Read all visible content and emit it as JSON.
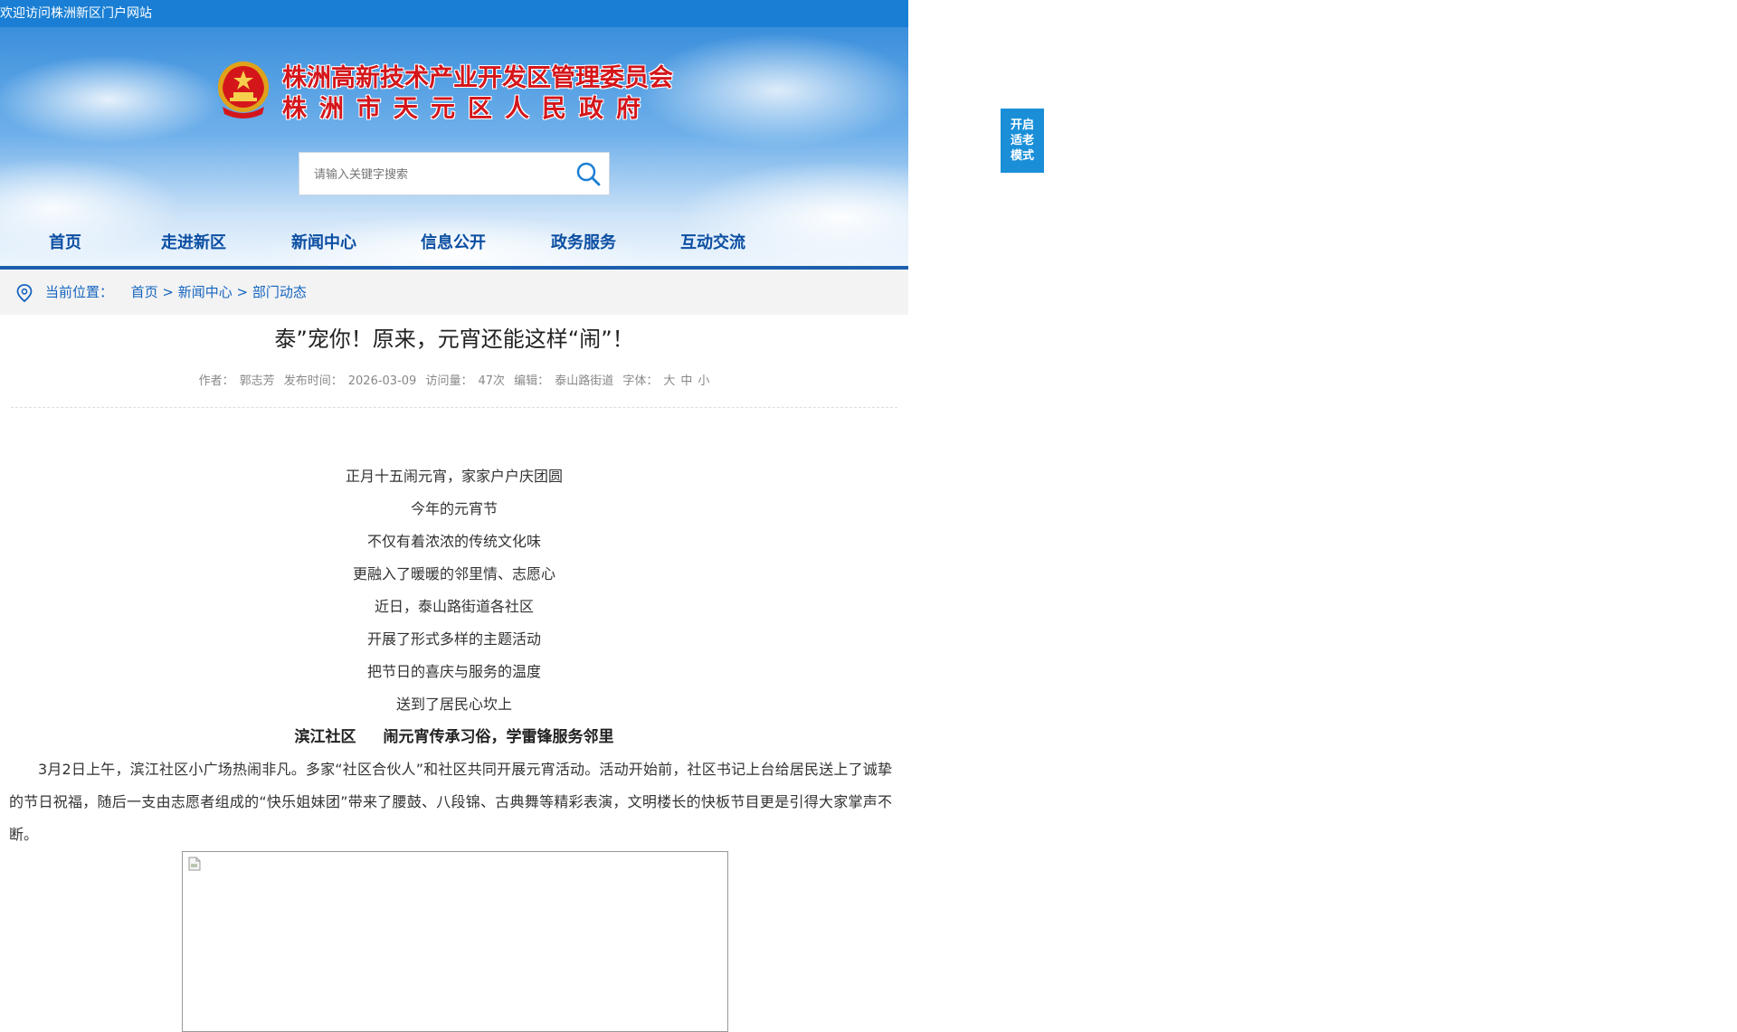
{
  "topbar": {
    "welcome": "欢迎访问株洲新区门户网站"
  },
  "header": {
    "title_line1": "株洲高新技术产业开发区管理委员会",
    "title_line2": "株洲市天元区人民政府",
    "search_placeholder": "请输入关键字搜索"
  },
  "nav": {
    "items": [
      "首页",
      "走进新区",
      "新闻中心",
      "信息公开",
      "政务服务",
      "互动交流"
    ]
  },
  "breadcrumb": {
    "label": "当前位置：",
    "path": [
      "首页",
      "新闻中心",
      "部门动态"
    ],
    "separator": ">"
  },
  "article": {
    "title": "泰”宠你！原来，元宵还能这样“闹”！",
    "meta": {
      "author_label": "作者：",
      "author": "郭志芳",
      "date_label": "发布时间：",
      "date": "2026-03-09",
      "views_label": "访问量：",
      "views": "47次",
      "editor_label": "编辑：",
      "editor": "泰山路街道",
      "font_label": "字体：",
      "font_large": "大",
      "font_medium": "中",
      "font_small": "小"
    },
    "poem": [
      "正月十五闹元宵，家家户户庆团圆",
      "今年的元宵节",
      "不仅有着浓浓的传统文化味",
      "更融入了暖暖的邻里情、志愿心",
      "近日，泰山路街道各社区",
      "开展了形式多样的主题活动",
      "把节日的喜庆与服务的温度",
      "送到了居民心坎上"
    ],
    "subhead_left": "滨江社区",
    "subhead_right": "闹元宵传承习俗，学雷锋服务邻里",
    "paragraph": "3月2日上午，滨江社区小广场热闹非凡。多家“社区合伙人”和社区共同开展元宵活动。活动开始前，社区书记上台给居民送上了诚挚的节日祝福，随后一支由志愿者组成的“快乐姐妹团”带来了腰鼓、八段锦、古典舞等精彩表演，文明楼长的快板节目更是引得大家掌声不断。"
  },
  "elder_mode": {
    "line1": "开启",
    "line2": "适老",
    "line3": "模式"
  },
  "colors": {
    "topbar": "#1a7fd4",
    "title_red": "#d4161b",
    "nav_blue": "#0b4ea2",
    "elder_button": "#1a8fd8"
  }
}
